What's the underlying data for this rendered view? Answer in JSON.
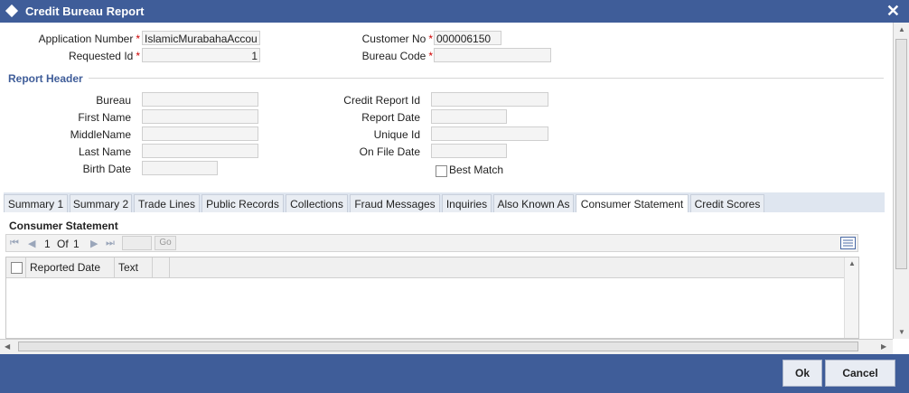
{
  "window": {
    "title": "Credit Bureau Report",
    "close_glyph": "✕"
  },
  "header_fields": {
    "application_number": {
      "label": "Application Number",
      "value": "IslamicMurabahaAccou"
    },
    "requested_id": {
      "label": "Requested Id",
      "value": "1"
    },
    "customer_no": {
      "label": "Customer No",
      "value": "000006150"
    },
    "bureau_code": {
      "label": "Bureau Code",
      "value": ""
    },
    "required_mark": "*"
  },
  "report_header": {
    "title": "Report Header",
    "bureau": {
      "label": "Bureau",
      "value": ""
    },
    "first_name": {
      "label": "First Name",
      "value": ""
    },
    "middle_name": {
      "label": "MiddleName",
      "value": ""
    },
    "last_name": {
      "label": "Last Name",
      "value": ""
    },
    "birth_date": {
      "label": "Birth Date",
      "value": ""
    },
    "credit_report_id": {
      "label": "Credit Report Id",
      "value": ""
    },
    "report_date": {
      "label": "Report Date",
      "value": ""
    },
    "unique_id": {
      "label": "Unique Id",
      "value": ""
    },
    "on_file_date": {
      "label": "On File Date",
      "value": ""
    },
    "best_match": {
      "label": "Best Match",
      "checked": false
    }
  },
  "tabs": [
    {
      "label": "Summary 1"
    },
    {
      "label": "Summary 2"
    },
    {
      "label": "Trade Lines"
    },
    {
      "label": "Public Records"
    },
    {
      "label": "Collections"
    },
    {
      "label": "Fraud Messages"
    },
    {
      "label": "Inquiries"
    },
    {
      "label": "Also Known As"
    },
    {
      "label": "Consumer Statement",
      "active": true
    },
    {
      "label": "Credit Scores"
    }
  ],
  "consumer_statement": {
    "title": "Consumer Statement",
    "pager": {
      "current": "1",
      "of_label": "Of",
      "total": "1",
      "go_label": "Go",
      "jump_value": ""
    },
    "columns": [
      "Reported Date",
      "Text"
    ],
    "rows": []
  },
  "footer": {
    "ok_label": "Ok",
    "cancel_label": "Cancel"
  },
  "colors": {
    "titlebar": "#3f5d99",
    "section_title": "#3f5d99",
    "required": "#cc0000"
  }
}
